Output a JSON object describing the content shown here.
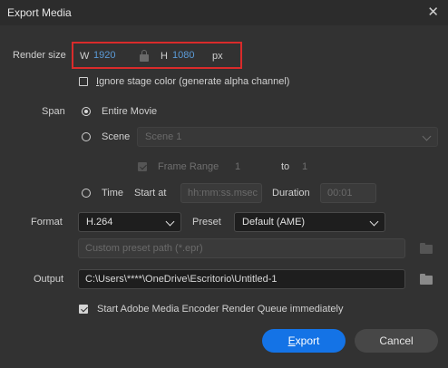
{
  "window": {
    "title": "Export Media"
  },
  "render_size": {
    "label": "Render size",
    "w_label": "W",
    "w_value": "1920",
    "h_label": "H",
    "h_value": "1080",
    "unit": "px"
  },
  "ignore_stage": {
    "label_first": "I",
    "label_rest": "gnore stage color (generate alpha channel)",
    "checked": false
  },
  "span": {
    "label": "Span",
    "entire_movie": "Entire Movie",
    "scene_label": "Scene",
    "scene_value": "Scene 1",
    "frame_range_label": "Frame Range",
    "frame_from": "1",
    "to_label": "to",
    "frame_to": "1",
    "time_label": "Time",
    "start_at_label": "Start at",
    "start_placeholder": "hh:mm:ss.msec",
    "duration_label": "Duration",
    "duration_value": "00:01"
  },
  "format": {
    "label": "Format",
    "value": "H.264",
    "preset_label": "Preset",
    "preset_value": "Default (AME)",
    "custom_preset_placeholder": "Custom preset path (*.epr)"
  },
  "output": {
    "label": "Output",
    "path": "C:\\Users\\****\\OneDrive\\Escritorio\\Untitled-1"
  },
  "encoder_queue": {
    "label": "Start Adobe Media Encoder Render Queue immediately",
    "checked": true
  },
  "buttons": {
    "export_first": "E",
    "export_rest": "xport",
    "cancel": "Cancel"
  },
  "colors": {
    "accent": "#1473e6",
    "highlight_box": "#d92b2b",
    "value_blue": "#5b9bd8",
    "background": "#323232"
  }
}
